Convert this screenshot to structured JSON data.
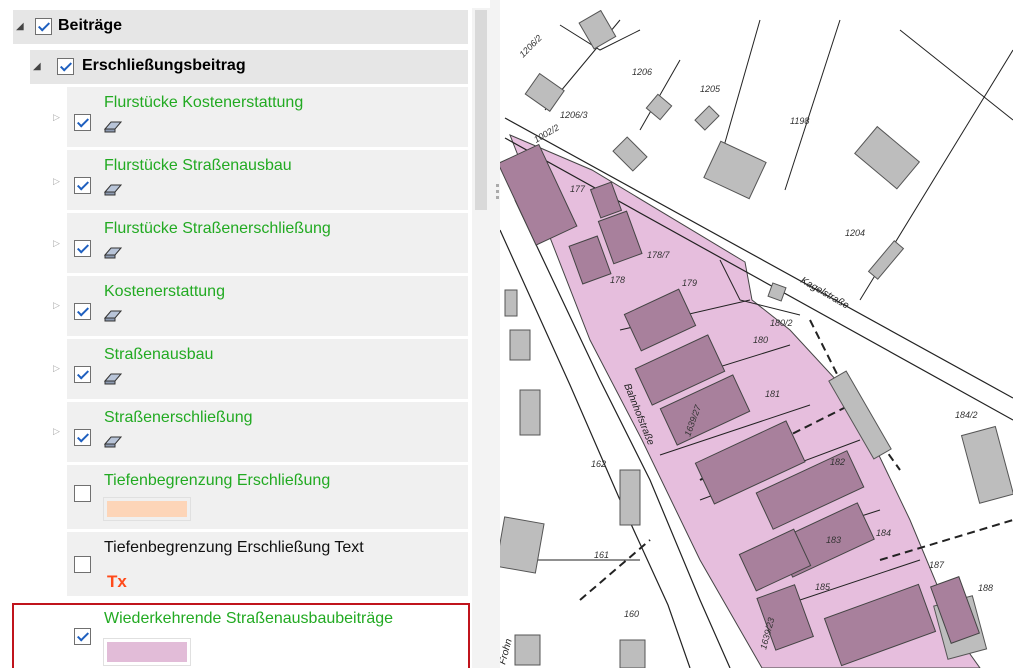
{
  "tree": {
    "root": {
      "label": "Beiträge",
      "checked": true
    },
    "group": {
      "label": "Erschließungsbeitrag",
      "checked": true
    },
    "items": [
      {
        "label": "Flurstücke Kostenerstattung",
        "checked": true,
        "expandable": true,
        "icon": "layer-icon",
        "color": "#22aa22"
      },
      {
        "label": "Flurstücke Straßenausbau",
        "checked": true,
        "expandable": true,
        "icon": "layer-icon",
        "color": "#22aa22"
      },
      {
        "label": "Flurstücke Straßenerschließung",
        "checked": true,
        "expandable": true,
        "icon": "layer-icon",
        "color": "#22aa22"
      },
      {
        "label": "Kostenerstattung",
        "checked": true,
        "expandable": true,
        "icon": "layer-icon",
        "color": "#22aa22"
      },
      {
        "label": "Straßenausbau",
        "checked": true,
        "expandable": true,
        "icon": "layer-icon",
        "color": "#22aa22"
      },
      {
        "label": "Straßenerschließung",
        "checked": true,
        "expandable": true,
        "icon": "layer-icon",
        "color": "#22aa22"
      },
      {
        "label": "Tiefenbegrenzung Erschließung",
        "checked": false,
        "expandable": false,
        "icon": "fill-swatch",
        "swatch_color": "#fdd5b8",
        "color": "#22aa22"
      },
      {
        "label": "Tiefenbegrenzung Erschließung Text",
        "checked": false,
        "expandable": false,
        "icon": "text-style",
        "icon_text": "Tx",
        "color": "#111111"
      },
      {
        "label": "Wiederkehrende Straßenausbaubeiträge",
        "checked": true,
        "expandable": false,
        "icon": "fill-swatch",
        "swatch_color": "#e2bcd8",
        "color": "#22aa22",
        "highlighted": true
      }
    ]
  },
  "map": {
    "parcel_labels": [
      "1206/2",
      "1206",
      "1205",
      "1206/3",
      "1198",
      "1002/2",
      "177",
      "177/3",
      "178",
      "178/7",
      "179",
      "1204",
      "180",
      "180/2",
      "181",
      "182",
      "183",
      "184",
      "184/2",
      "185",
      "187",
      "188",
      "162",
      "161",
      "160",
      "1639/27",
      "1639/23"
    ],
    "street_labels": [
      "Kagelstraße",
      "Bahnhofstraße",
      "Frohn"
    ],
    "colors": {
      "highlight_fill": "#e6bedd",
      "building": "#bdbdbd",
      "building_in_zone": "#a8809c"
    }
  }
}
